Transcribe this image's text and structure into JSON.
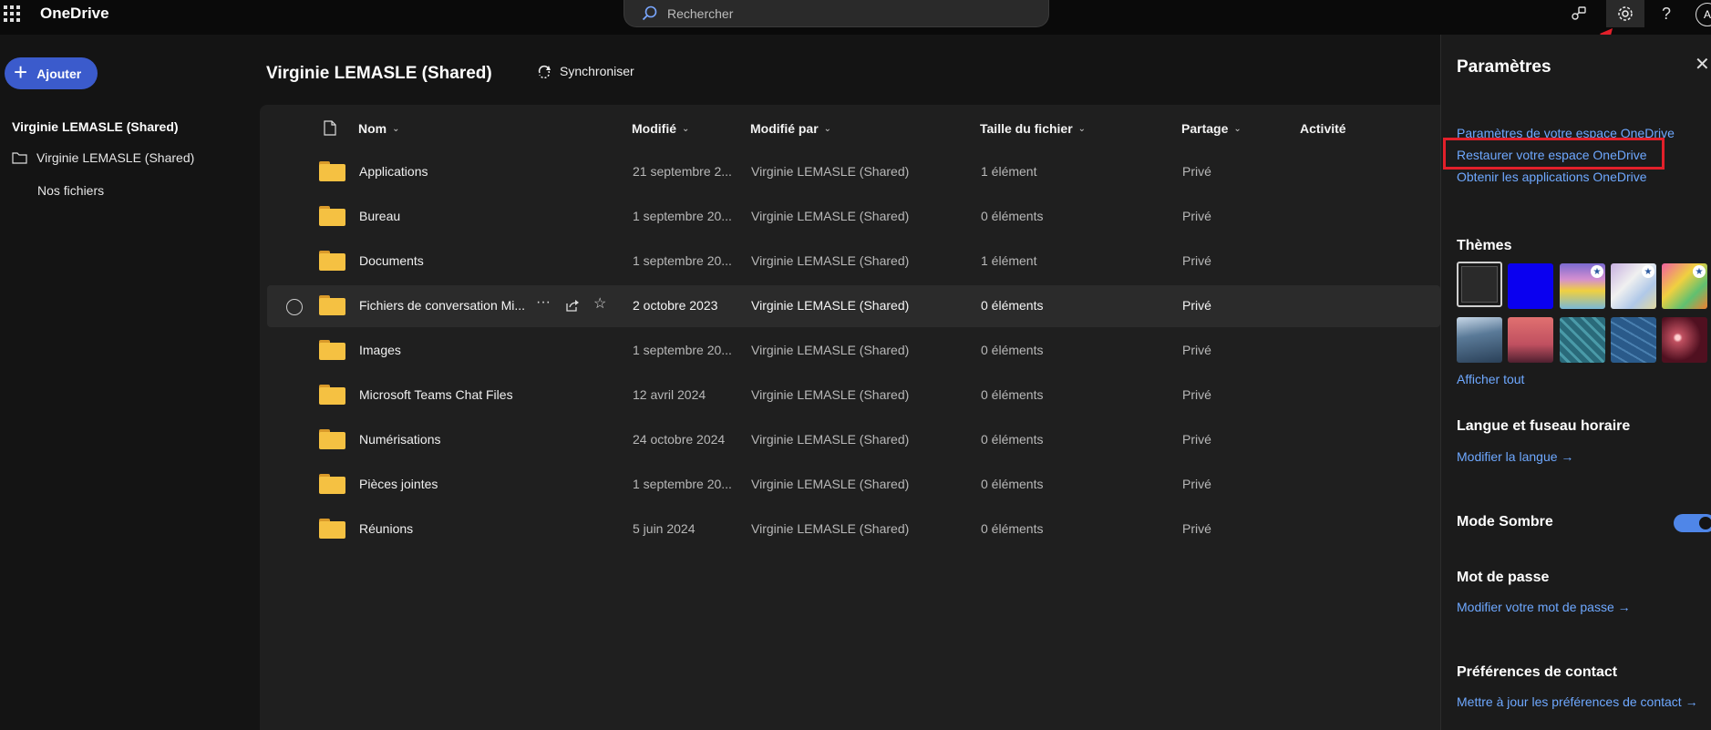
{
  "topbar": {
    "app_name": "OneDrive",
    "search_placeholder": "Rechercher",
    "avatar_initial": "A"
  },
  "sidebar": {
    "add_label": "Ajouter",
    "header": "Virginie LEMASLE (Shared)",
    "items": [
      {
        "label": "Virginie LEMASLE (Shared)"
      },
      {
        "label": "Nos fichiers"
      }
    ]
  },
  "main": {
    "title": "Virginie LEMASLE (Shared)",
    "sync_label": "Synchroniser",
    "columns": {
      "name": "Nom",
      "modified": "Modifié",
      "modified_by": "Modifié par",
      "size": "Taille du fichier",
      "sharing": "Partage",
      "activity": "Activité"
    },
    "rows": [
      {
        "name": "Applications",
        "modified": "21 septembre 2...",
        "modified_by": "Virginie LEMASLE (Shared)",
        "size": "1 élément",
        "sharing": "Privé"
      },
      {
        "name": "Bureau",
        "modified": "1 septembre 20...",
        "modified_by": "Virginie LEMASLE (Shared)",
        "size": "0 éléments",
        "sharing": "Privé"
      },
      {
        "name": "Documents",
        "modified": "1 septembre 20...",
        "modified_by": "Virginie LEMASLE (Shared)",
        "size": "1 élément",
        "sharing": "Privé"
      },
      {
        "name": "Fichiers de conversation Mi...",
        "modified": "2 octobre 2023",
        "modified_by": "Virginie LEMASLE (Shared)",
        "size": "0 éléments",
        "sharing": "Privé"
      },
      {
        "name": "Images",
        "modified": "1 septembre 20...",
        "modified_by": "Virginie LEMASLE (Shared)",
        "size": "0 éléments",
        "sharing": "Privé"
      },
      {
        "name": "Microsoft Teams Chat Files",
        "modified": "12 avril 2024",
        "modified_by": "Virginie LEMASLE (Shared)",
        "size": "0 éléments",
        "sharing": "Privé"
      },
      {
        "name": "Numérisations",
        "modified": "24 octobre 2024",
        "modified_by": "Virginie LEMASLE (Shared)",
        "size": "0 éléments",
        "sharing": "Privé"
      },
      {
        "name": "Pièces jointes",
        "modified": "1 septembre 20...",
        "modified_by": "Virginie LEMASLE (Shared)",
        "size": "0 éléments",
        "sharing": "Privé"
      },
      {
        "name": "Réunions",
        "modified": "5 juin 2024",
        "modified_by": "Virginie LEMASLE (Shared)",
        "size": "0 éléments",
        "sharing": "Privé"
      }
    ]
  },
  "settings": {
    "title": "Paramètres",
    "links": {
      "space_settings": "Paramètres de votre espace OneDrive",
      "restore": "Restaurer votre espace OneDrive",
      "get_apps": "Obtenir les applications OneDrive"
    },
    "themes_title": "Thèmes",
    "show_all": "Afficher tout",
    "language_title": "Langue et fuseau horaire",
    "language_link": "Modifier la langue →",
    "dark_mode_title": "Mode Sombre",
    "dark_mode_on": true,
    "password_title": "Mot de passe",
    "password_link": "Modifier votre mot de passe →",
    "contact_title": "Préférences de contact",
    "contact_link": "Mettre à jour les préférences de contact →"
  },
  "colors": {
    "accent": "#3b5bcc",
    "link": "#6ea8ff",
    "highlight": "#e2202a",
    "folder": "#f5c142"
  }
}
